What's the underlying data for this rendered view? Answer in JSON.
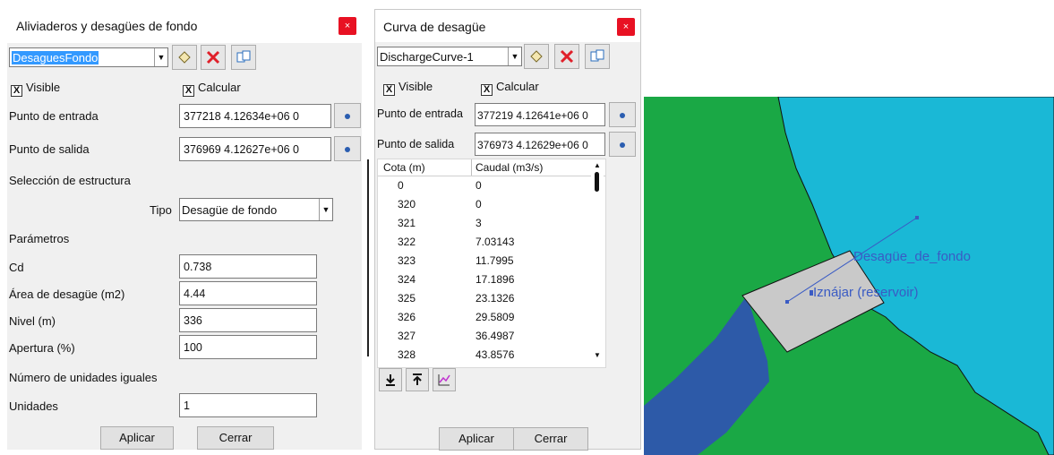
{
  "left_dialog": {
    "title": "Aliviaderos y desagües de fondo",
    "close_label": "×",
    "selector_value": "DesaguesFondo",
    "visible_label": "Visible",
    "calcular_label": "Calcular",
    "check_mark": "X",
    "entrada_label": "Punto de entrada",
    "entrada_value": "377218 4.12634e+06 0",
    "salida_label": "Punto de salida",
    "salida_value": "376969 4.12627e+06 0",
    "seleccion_label": "Selección de estructura",
    "tipo_label": "Tipo",
    "tipo_value": "Desagüe de fondo",
    "parametros_label": "Parámetros",
    "params": [
      {
        "label": "Cd",
        "value": "0.738"
      },
      {
        "label": "Área de desagüe (m2)",
        "value": "4.44"
      },
      {
        "label": "Nivel (m)",
        "value": "336"
      },
      {
        "label": "Apertura (%)",
        "value": "100"
      }
    ],
    "unidades_header": "Número de unidades iguales",
    "unidades_label": "Unidades",
    "unidades_value": "1",
    "apply_label": "Aplicar",
    "close_button_label": "Cerrar"
  },
  "right_dialog": {
    "title": "Curva de desagüe",
    "close_label": "×",
    "selector_value": "DischargeCurve-1",
    "visible_label": "Visible",
    "calcular_label": "Calcular",
    "check_mark": "X",
    "entrada_label": "Punto de entrada",
    "entrada_value": "377219 4.12641e+06 0",
    "salida_label": "Punto de salida",
    "salida_value": "376973 4.12629e+06 0",
    "table_headers": [
      "Cota (m)",
      "Caudal (m3/s)"
    ],
    "rows": [
      [
        "0",
        "0"
      ],
      [
        "320",
        "0"
      ],
      [
        "321",
        "3"
      ],
      [
        "322",
        "7.03143"
      ],
      [
        "323",
        "11.7995"
      ],
      [
        "324",
        "17.1896"
      ],
      [
        "325",
        "23.1326"
      ],
      [
        "326",
        "29.5809"
      ],
      [
        "327",
        "36.4987"
      ],
      [
        "328",
        "43.8576"
      ]
    ],
    "apply_label": "Aplicar",
    "close_button_label": "Cerrar"
  },
  "map": {
    "label_structure": "Desagüe_de_fondo",
    "label_reservoir": "Iznájar (reservoir)",
    "colors": {
      "land": "#1aa845",
      "water": "#1ab8d6",
      "channel": "#2d5aa8",
      "structure": "#c9c9c9",
      "label": "#3a5bc4"
    }
  },
  "icons": {
    "selector_arrow": "chevron-down-icon",
    "add": "new-item-icon",
    "delete": "delete-icon",
    "copy": "copy-icon",
    "pick": "pick-point-icon",
    "import": "import-icon",
    "export": "export-icon",
    "chart": "chart-icon"
  }
}
